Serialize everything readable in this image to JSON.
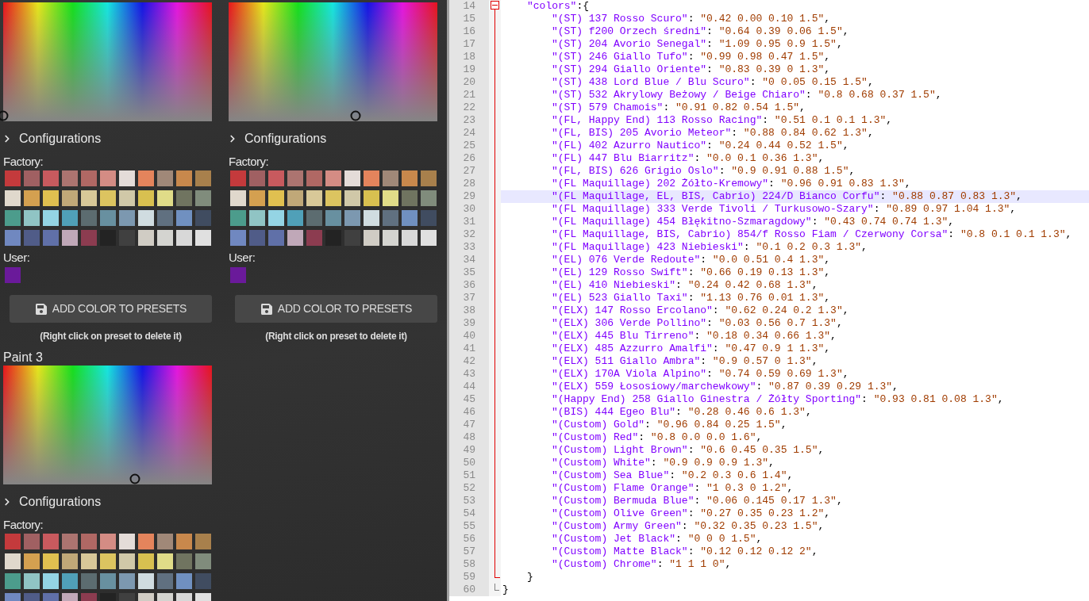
{
  "panels": [
    {
      "picker": {
        "hue": {
          "level": 0
        }
      },
      "configurations": {
        "label": "Configurations",
        "expanded": false
      },
      "factory_label": "Factory:",
      "factory_swatches": [
        {
          "color": "#c43a3c"
        },
        {
          "color": "#a06062"
        },
        {
          "color": "#c85a5e"
        },
        {
          "color": "#ac7470"
        },
        {
          "color": "#b06864"
        },
        {
          "color": "#d48c84"
        },
        {
          "color": "#e4dcd8"
        },
        {
          "color": "#e4845c"
        },
        {
          "color": "#a08878"
        },
        {
          "color": "#c8884c"
        },
        {
          "color": "#a8804c"
        },
        {
          "color": "#e0d8cc"
        },
        {
          "color": "#d4a050"
        },
        {
          "color": "#e0c050"
        },
        {
          "color": "#c0a878"
        },
        {
          "color": "#d8c898"
        },
        {
          "color": "#dcc460"
        },
        {
          "color": "#d0c8a8"
        },
        {
          "color": "#d8c050"
        },
        {
          "color": "#e0dc88"
        },
        {
          "color": "#707460"
        },
        {
          "color": "#808c7c"
        },
        {
          "color": "#4c9c8c"
        },
        {
          "color": "#90c4c4"
        },
        {
          "color": "#94d4e4"
        },
        {
          "color": "#50a0b8"
        },
        {
          "color": "#5c6c70"
        },
        {
          "color": "#6890a0"
        },
        {
          "color": "#7c98b0"
        },
        {
          "color": "#d0dce0"
        },
        {
          "color": "#607080"
        },
        {
          "color": "#7090c0"
        },
        {
          "color": "#404c60"
        },
        {
          "color": "#7088c0"
        },
        {
          "color": "#505c88"
        },
        {
          "color": "#6070a8"
        },
        {
          "color": "#c0a8b8"
        },
        {
          "color": "#8c3c50"
        },
        {
          "color": "#232323"
        },
        {
          "color": "#404040"
        },
        {
          "color": "#d0ccc4"
        },
        {
          "color": "#d4d4d0"
        },
        {
          "color": "#d8d8d8"
        },
        {
          "color": "#e0e0e0"
        }
      ],
      "user_label": "User:",
      "user_swatches": [
        {
          "color": "#6a1a9a"
        }
      ],
      "add_button": "ADD COLOR TO PRESETS",
      "hint": "(Right click on preset to delete it)"
    },
    {
      "picker": {
        "hue": {
          "level": 0.61
        }
      },
      "configurations": {
        "label": "Configurations",
        "expanded": false
      },
      "factory_label": "Factory:",
      "factory_swatches": [
        {
          "color": "#c43a3c"
        },
        {
          "color": "#a06062"
        },
        {
          "color": "#c85a5e"
        },
        {
          "color": "#ac7470"
        },
        {
          "color": "#b06864"
        },
        {
          "color": "#d48c84"
        },
        {
          "color": "#e4dcd8"
        },
        {
          "color": "#e4845c"
        },
        {
          "color": "#a08878"
        },
        {
          "color": "#c8884c"
        },
        {
          "color": "#a8804c"
        },
        {
          "color": "#e0d8cc"
        },
        {
          "color": "#d4a050"
        },
        {
          "color": "#e0c050"
        },
        {
          "color": "#c0a878"
        },
        {
          "color": "#d8c898"
        },
        {
          "color": "#dcc460"
        },
        {
          "color": "#d0c8a8"
        },
        {
          "color": "#d8c050"
        },
        {
          "color": "#e0dc88"
        },
        {
          "color": "#707460"
        },
        {
          "color": "#808c7c"
        },
        {
          "color": "#4c9c8c"
        },
        {
          "color": "#90c4c4"
        },
        {
          "color": "#94d4e4"
        },
        {
          "color": "#50a0b8"
        },
        {
          "color": "#5c6c70"
        },
        {
          "color": "#6890a0"
        },
        {
          "color": "#7c98b0"
        },
        {
          "color": "#d0dce0"
        },
        {
          "color": "#607080"
        },
        {
          "color": "#7090c0"
        },
        {
          "color": "#404c60"
        },
        {
          "color": "#7088c0"
        },
        {
          "color": "#505c88"
        },
        {
          "color": "#6070a8"
        },
        {
          "color": "#c0a8b8"
        },
        {
          "color": "#8c3c50"
        },
        {
          "color": "#232323"
        },
        {
          "color": "#404040"
        },
        {
          "color": "#d0ccc4"
        },
        {
          "color": "#d4d4d0"
        },
        {
          "color": "#d8d8d8"
        },
        {
          "color": "#e0e0e0"
        }
      ],
      "user_label": "User:",
      "user_swatches": [
        {
          "color": "#6a1a9a"
        }
      ],
      "add_button": "ADD COLOR TO PRESETS",
      "hint": "(Right click on preset to delete it)"
    },
    {
      "title": "Paint 3",
      "picker": {
        "hue": {
          "level": 0.63
        }
      },
      "configurations": {
        "label": "Configurations",
        "expanded": false
      },
      "factory_label": "Factory:",
      "factory_swatches": [
        {
          "color": "#c43a3c"
        },
        {
          "color": "#a06062"
        },
        {
          "color": "#c85a5e"
        },
        {
          "color": "#ac7470"
        },
        {
          "color": "#b06864"
        },
        {
          "color": "#d48c84"
        },
        {
          "color": "#e4dcd8"
        },
        {
          "color": "#e4845c"
        },
        {
          "color": "#a08878"
        },
        {
          "color": "#c8884c"
        },
        {
          "color": "#a8804c"
        },
        {
          "color": "#e0d8cc"
        },
        {
          "color": "#d4a050"
        },
        {
          "color": "#e0c050"
        },
        {
          "color": "#c0a878"
        },
        {
          "color": "#d8c898"
        },
        {
          "color": "#dcc460"
        },
        {
          "color": "#d0c8a8"
        },
        {
          "color": "#d8c050"
        },
        {
          "color": "#e0dc88"
        },
        {
          "color": "#707460"
        },
        {
          "color": "#808c7c"
        },
        {
          "color": "#4c9c8c"
        },
        {
          "color": "#90c4c4"
        },
        {
          "color": "#94d4e4"
        },
        {
          "color": "#50a0b8"
        },
        {
          "color": "#5c6c70"
        },
        {
          "color": "#6890a0"
        },
        {
          "color": "#7c98b0"
        },
        {
          "color": "#d0dce0"
        },
        {
          "color": "#607080"
        },
        {
          "color": "#7090c0"
        },
        {
          "color": "#404c60"
        },
        {
          "color": "#7088c0"
        },
        {
          "color": "#505c88"
        },
        {
          "color": "#6070a8"
        },
        {
          "color": "#c0a8b8"
        },
        {
          "color": "#8c3c50"
        },
        {
          "color": "#232323"
        },
        {
          "color": "#404040"
        },
        {
          "color": "#d0ccc4"
        },
        {
          "color": "#d4d4d0"
        },
        {
          "color": "#d8d8d8"
        },
        {
          "color": "#e0e0e0"
        }
      ]
    }
  ],
  "editor": {
    "lines": [
      {
        "number": "14",
        "kind": "open",
        "current": false,
        "key": "\"colors\"",
        "colon": ":{"
      },
      {
        "number": "15",
        "kind": "entry",
        "current": false,
        "key": "\"(ST) 137 Rosso Scuro\"",
        "colon": ": ",
        "value": "\"0.42 0.00 0.10 1.5\"",
        "end": ","
      },
      {
        "number": "16",
        "kind": "entry",
        "current": false,
        "key": "\"(ST) f200 Orzech średni\"",
        "colon": ": ",
        "value": "\"0.64 0.39 0.06 1.5\"",
        "end": ","
      },
      {
        "number": "17",
        "kind": "entry",
        "current": false,
        "key": "\"(ST) 204 Avorio Senegal\"",
        "colon": ": ",
        "value": "\"1.09 0.95 0.9 1.5\"",
        "end": ","
      },
      {
        "number": "18",
        "kind": "entry",
        "current": false,
        "key": "\"(ST) 246 Giallo Tufo\"",
        "colon": ": ",
        "value": "\"0.99 0.98 0.47 1.5\"",
        "end": ","
      },
      {
        "number": "19",
        "kind": "entry",
        "current": false,
        "key": "\"(ST) 294 Giallo Oriente\"",
        "colon": ": ",
        "value": "\"0.83 0.39 0 1.3\"",
        "end": ","
      },
      {
        "number": "20",
        "kind": "entry",
        "current": false,
        "key": "\"(ST) 438 Lord Blue / Blu Scuro\"",
        "colon": ": ",
        "value": "\"0 0.05 0.15 1.5\"",
        "end": ","
      },
      {
        "number": "21",
        "kind": "entry",
        "current": false,
        "key": "\"(ST) 532 Akrylowy Beżowy / Beige Chiaro\"",
        "colon": ": ",
        "value": "\"0.8 0.68 0.37 1.5\"",
        "end": ","
      },
      {
        "number": "22",
        "kind": "entry",
        "current": false,
        "key": "\"(ST) 579 Chamois\"",
        "colon": ": ",
        "value": "\"0.91 0.82 0.54 1.5\"",
        "end": ","
      },
      {
        "number": "23",
        "kind": "entry",
        "current": false,
        "key": "\"(FL, Happy End) 113 Rosso Racing\"",
        "colon": ": ",
        "value": "\"0.51 0.1 0.1 1.3\"",
        "end": ","
      },
      {
        "number": "24",
        "kind": "entry",
        "current": false,
        "key": "\"(FL, BIS) 205 Avorio Meteor\"",
        "colon": ": ",
        "value": "\"0.88 0.84 0.62 1.3\"",
        "end": ","
      },
      {
        "number": "25",
        "kind": "entry",
        "current": false,
        "key": "\"(FL) 402 Azurro Nautico\"",
        "colon": ": ",
        "value": "\"0.24 0.44 0.52 1.5\"",
        "end": ","
      },
      {
        "number": "26",
        "kind": "entry",
        "current": false,
        "key": "\"(FL) 447 Blu Biarritz\"",
        "colon": ": ",
        "value": "\"0.0 0.1 0.36 1.3\"",
        "end": ","
      },
      {
        "number": "27",
        "kind": "entry",
        "current": false,
        "key": "\"(FL, BIS) 626 Grigio Oslo\"",
        "colon": ": ",
        "value": "\"0.9 0.91 0.88 1.5\"",
        "end": ","
      },
      {
        "number": "28",
        "kind": "entry",
        "current": false,
        "key": "\"(FL Maquillage) 202 Żółto-Kremowy\"",
        "colon": ": ",
        "value": "\"0.96 0.91 0.83 1.3\"",
        "end": ","
      },
      {
        "number": "29",
        "kind": "entry",
        "current": true,
        "key": "\"(FL Maquillage, EL, BIS, Cabrio) 224/D Bianco Corfu\"",
        "colon": ": ",
        "value": "\"0.88 0.87 0.83 1.3\"",
        "end": ","
      },
      {
        "number": "30",
        "kind": "entry",
        "current": false,
        "key": "\"(FL Maquillage) 333 Verde Tivoli / Turkusowo-Szary\"",
        "colon": ": ",
        "value": "\"0.89 0.97 1.04 1.3\"",
        "end": ","
      },
      {
        "number": "31",
        "kind": "entry",
        "current": false,
        "key": "\"(FL Maquillage) 454 Błękitno-Szmaragdowy\"",
        "colon": ": ",
        "value": "\"0.43 0.74 0.74 1.3\"",
        "end": ","
      },
      {
        "number": "32",
        "kind": "entry",
        "current": false,
        "key": "\"(FL Maquillage, BIS, Cabrio) 854/f Rosso Fiam / Czerwony Corsa\"",
        "colon": ": ",
        "value": "\"0.8 0.1 0.1 1.3\"",
        "end": ","
      },
      {
        "number": "33",
        "kind": "entry",
        "current": false,
        "key": "\"(FL Maquillage) 423 Niebieski\"",
        "colon": ": ",
        "value": "\"0.1 0.2 0.3 1.3\"",
        "end": ","
      },
      {
        "number": "34",
        "kind": "entry",
        "current": false,
        "key": "\"(EL) 076 Verde Redoute\"",
        "colon": ": ",
        "value": "\"0.0 0.51 0.4 1.3\"",
        "end": ","
      },
      {
        "number": "35",
        "kind": "entry",
        "current": false,
        "key": "\"(EL) 129 Rosso Swift\"",
        "colon": ": ",
        "value": "\"0.66 0.19 0.13 1.3\"",
        "end": ","
      },
      {
        "number": "36",
        "kind": "entry",
        "current": false,
        "key": "\"(EL) 410 Niebieski\"",
        "colon": ": ",
        "value": "\"0.24 0.42 0.68 1.3\"",
        "end": ","
      },
      {
        "number": "37",
        "kind": "entry",
        "current": false,
        "key": "\"(EL) 523 Giallo Taxi\"",
        "colon": ": ",
        "value": "\"1.13 0.76 0.01 1.3\"",
        "end": ","
      },
      {
        "number": "38",
        "kind": "entry",
        "current": false,
        "key": "\"(ELX) 147 Rosso Ercolano\"",
        "colon": ": ",
        "value": "\"0.62 0.24 0.2 1.3\"",
        "end": ","
      },
      {
        "number": "39",
        "kind": "entry",
        "current": false,
        "key": "\"(ELX) 306 Verde Pollino\"",
        "colon": ": ",
        "value": "\"0.03 0.56 0.7 1.3\"",
        "end": ","
      },
      {
        "number": "40",
        "kind": "entry",
        "current": false,
        "key": "\"(ELX) 445 Blu Tirreno\"",
        "colon": ": ",
        "value": "\"0.18 0.34 0.66 1.3\"",
        "end": ","
      },
      {
        "number": "41",
        "kind": "entry",
        "current": false,
        "key": "\"(ELX) 485 Azzurro Amalfi\"",
        "colon": ": ",
        "value": "\"0.47 0.9 1 1.3\"",
        "end": ","
      },
      {
        "number": "42",
        "kind": "entry",
        "current": false,
        "key": "\"(ELX) 511 Giallo Ambra\"",
        "colon": ": ",
        "value": "\"0.9 0.57 0 1.3\"",
        "end": ","
      },
      {
        "number": "43",
        "kind": "entry",
        "current": false,
        "key": "\"(ELX) 170A Viola Alpino\"",
        "colon": ": ",
        "value": "\"0.74 0.59 0.69 1.3\"",
        "end": ","
      },
      {
        "number": "44",
        "kind": "entry",
        "current": false,
        "key": "\"(ELX) 559 Łososiowy/marchewkowy\"",
        "colon": ": ",
        "value": "\"0.87 0.39 0.29 1.3\"",
        "end": ","
      },
      {
        "number": "45",
        "kind": "entry",
        "current": false,
        "key": "\"(Happy End) 258 Giallo Ginestra / Żółty Sporting\"",
        "colon": ": ",
        "value": "\"0.93 0.81 0.08 1.3\"",
        "end": ","
      },
      {
        "number": "46",
        "kind": "entry",
        "current": false,
        "key": "\"(BIS) 444 Egeo Blu\"",
        "colon": ": ",
        "value": "\"0.28 0.46 0.6 1.3\"",
        "end": ","
      },
      {
        "number": "47",
        "kind": "entry",
        "current": false,
        "key": "\"(Custom) Gold\"",
        "colon": ": ",
        "value": "\"0.96 0.84 0.25 1.5\"",
        "end": ","
      },
      {
        "number": "48",
        "kind": "entry",
        "current": false,
        "key": "\"(Custom) Red\"",
        "colon": ": ",
        "value": "\"0.8 0.0 0.0 1.6\"",
        "end": ","
      },
      {
        "number": "49",
        "kind": "entry",
        "current": false,
        "key": "\"(Custom) Light Brown\"",
        "colon": ": ",
        "value": "\"0.6 0.45 0.35 1.5\"",
        "end": ","
      },
      {
        "number": "50",
        "kind": "entry",
        "current": false,
        "key": "\"(Custom) White\"",
        "colon": ": ",
        "value": "\"0.9 0.9 0.9 1.3\"",
        "end": ","
      },
      {
        "number": "51",
        "kind": "entry",
        "current": false,
        "key": "\"(Custom) Sea Blue\"",
        "colon": ": ",
        "value": "\"0.2 0.3 0.6 1.4\"",
        "end": ","
      },
      {
        "number": "52",
        "kind": "entry",
        "current": false,
        "key": "\"(Custom) Flame Orange\"",
        "colon": ": ",
        "value": "\"1 0.3 0 1.2\"",
        "end": ","
      },
      {
        "number": "53",
        "kind": "entry",
        "current": false,
        "key": "\"(Custom) Bermuda Blue\"",
        "colon": ": ",
        "value": "\"0.06 0.145 0.17 1.3\"",
        "end": ","
      },
      {
        "number": "54",
        "kind": "entry",
        "current": false,
        "key": "\"(Custom) Olive Green\"",
        "colon": ": ",
        "value": "\"0.27 0.35 0.23 1.2\"",
        "end": ","
      },
      {
        "number": "55",
        "kind": "entry",
        "current": false,
        "key": "\"(Custom) Army Green\"",
        "colon": ": ",
        "value": "\"0.32 0.35 0.23 1.5\"",
        "end": ","
      },
      {
        "number": "56",
        "kind": "entry",
        "current": false,
        "key": "\"(Custom) Jet Black\"",
        "colon": ": ",
        "value": "\"0 0 0 1.5\"",
        "end": ","
      },
      {
        "number": "57",
        "kind": "entry",
        "current": false,
        "key": "\"(Custom) Matte Black\"",
        "colon": ": ",
        "value": "\"0.12 0.12 0.12 2\"",
        "end": ","
      },
      {
        "number": "58",
        "kind": "entry",
        "current": false,
        "key": "\"(Custom) Chrome\"",
        "colon": ": ",
        "value": "\"1 1 1 0\"",
        "end": ","
      },
      {
        "number": "59",
        "kind": "close",
        "current": false,
        "end": "}"
      },
      {
        "number": "60",
        "kind": "end",
        "current": false,
        "end": "}"
      }
    ]
  }
}
